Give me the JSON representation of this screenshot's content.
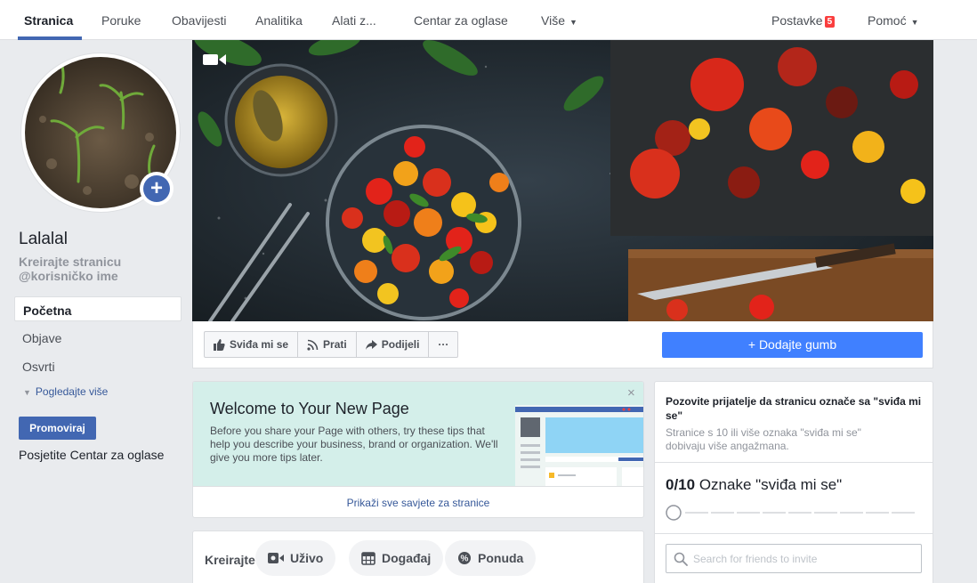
{
  "topnav": {
    "tabs": [
      "Stranica",
      "Poruke",
      "Obavijesti",
      "Analitika",
      "Alati z...",
      "Centar za oglase",
      "Više"
    ],
    "settings_label": "Postavke",
    "settings_badge": "5",
    "help_label": "Pomoć"
  },
  "page": {
    "name": "Lalalal",
    "sub1": "Kreirajte stranicu",
    "sub2": "@korisničko ime"
  },
  "leftnav": {
    "items": [
      "Početna",
      "Objave",
      "Osvrti"
    ],
    "see_more": "Pogledajte više",
    "promote": "Promoviraj",
    "ads_center": "Posjetite Centar za oglase"
  },
  "actions": {
    "like": "Sviđa mi se",
    "follow": "Prati",
    "share": "Podijeli",
    "more": "···",
    "add_button": "+ Dodajte gumb"
  },
  "welcome": {
    "title": "Welcome to Your New Page",
    "text": "Before you share your Page with others, try these tips that help you describe your business, brand or organization. We'll give you more tips later.",
    "close": "×",
    "link": "Prikaži sve savjete za stranice"
  },
  "create": {
    "label": "Kreirajte",
    "live": "Uživo",
    "event": "Događaj",
    "offer": "Ponuda"
  },
  "invite": {
    "title": "Pozovite prijatelje da stranicu označe sa \"sviđa mi se\"",
    "sub": "Stranice s 10 ili više oznaka \"sviđa mi se\" dobivaju više angažmana.",
    "count": "0/10",
    "count_label": " Oznake \"sviđa mi se\"",
    "progress_value": 0,
    "progress_max": 10,
    "search_placeholder": "Search for friends to invite"
  },
  "colors": {
    "brand": "#4267b2",
    "primary_button": "#4080ff",
    "badge": "#fa3e3e",
    "welcome_bg": "#d4efea"
  }
}
